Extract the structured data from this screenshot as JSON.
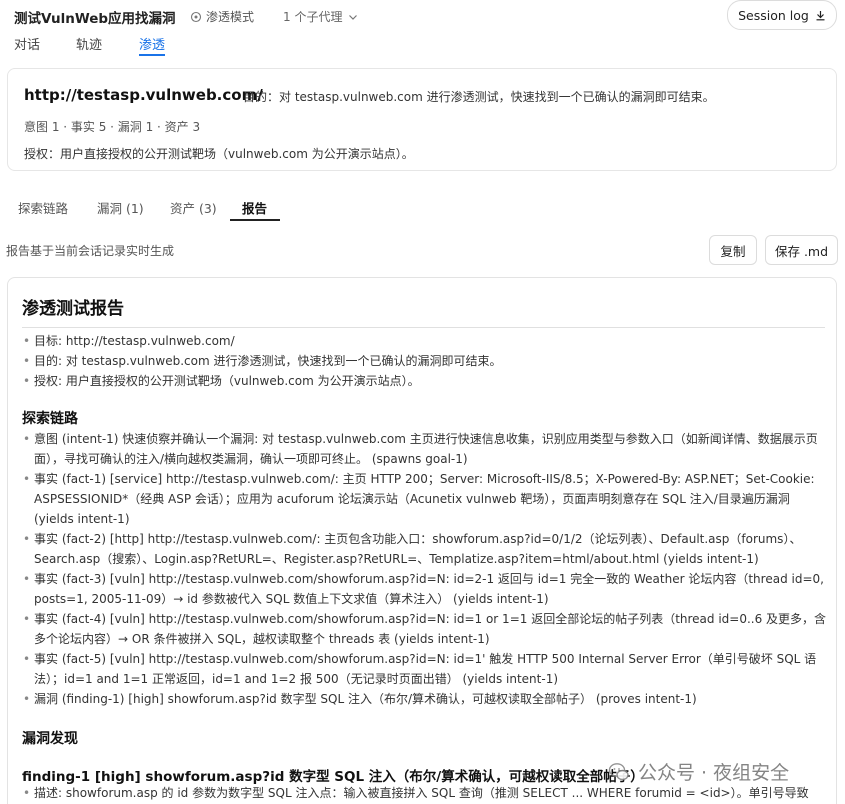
{
  "header": {
    "title": "测试VulnWeb应用找漏洞",
    "mode": "渗透模式",
    "agents": "1 个子代理",
    "session_log": "Session log"
  },
  "main_tabs": [
    "对话",
    "轨迹",
    "渗透"
  ],
  "target": {
    "url": "http://testasp.vulnweb.com/",
    "goal": "目的：对 testasp.vulnweb.com 进行渗透测试，快速找到一个已确认的漏洞即可结束。",
    "stats": "意图 1 · 事实 5 · 漏洞 1 · 资产 3",
    "auth": "授权：用户直接授权的公开测试靶场（vulnweb.com 为公开演示站点）。"
  },
  "sub_tabs": [
    "探索链路",
    "漏洞 (1)",
    "资产 (3)",
    "报告"
  ],
  "report_note": "报告基于当前会话记录实时生成",
  "buttons": {
    "copy": "复制",
    "save": "保存 .md"
  },
  "report": {
    "title": "渗透测试报告",
    "summary": [
      "目标: http://testasp.vulnweb.com/",
      "目的: 对 testasp.vulnweb.com 进行渗透测试，快速找到一个已确认的漏洞即可结束。",
      "授权: 用户直接授权的公开测试靶场（vulnweb.com 为公开演示站点）。"
    ],
    "chain_title": "探索链路",
    "chain": [
      "意图 (intent-1) 快速侦察并确认一个漏洞: 对 testasp.vulnweb.com 主页进行快速信息收集，识别应用类型与参数入口（如新闻详情、数据展示页面），寻找可确认的注入/横向越权类漏洞，确认一项即可终止。 (spawns goal-1)",
      "事实 (fact-1) [service] http://testasp.vulnweb.com/: 主页 HTTP 200；Server: Microsoft-IIS/8.5；X-Powered-By: ASP.NET；Set-Cookie: ASPSESSIONID*（经典 ASP 会话）；应用为 acuforum 论坛演示站（Acunetix vulnweb 靶场），页面声明刻意存在 SQL 注入/目录遍历漏洞 (yields intent-1)",
      "事实 (fact-2) [http] http://testasp.vulnweb.com/: 主页包含功能入口：showforum.asp?id=0/1/2（论坛列表）、Default.asp（forums）、Search.asp（搜索）、Login.asp?RetURL=、Register.asp?RetURL=、Templatize.asp?item=html/about.html (yields intent-1)",
      "事实 (fact-3) [vuln] http://testasp.vulnweb.com/showforum.asp?id=N: id=2-1 返回与 id=1 完全一致的 Weather 论坛内容（thread id=0, posts=1, 2005-11-09）→ id 参数被代入 SQL 数值上下文求值（算术注入） (yields intent-1)",
      "事实 (fact-4) [vuln] http://testasp.vulnweb.com/showforum.asp?id=N: id=1 or 1=1 返回全部论坛的帖子列表（thread id=0..6 及更多，含多个论坛内容）→ OR 条件被拼入 SQL，越权读取整个 threads 表 (yields intent-1)",
      "事实 (fact-5) [vuln] http://testasp.vulnweb.com/showforum.asp?id=N: id=1' 触发 HTTP 500 Internal Server Error（单引号破坏 SQL 语法）；id=1 and 1=1 正常返回，id=1 and 1=2 报 500（无记录时页面出错） (yields intent-1)",
      "漏洞 (finding-1) [high] showforum.asp?id 数字型 SQL 注入（布尔/算术确认，可越权读取全部帖子） (proves intent-1)"
    ],
    "findings_title": "漏洞发现",
    "finding_heading": "finding-1 [high] showforum.asp?id 数字型 SQL 注入（布尔/算术确认，可越权读取全部帖子）",
    "finding_items": [
      "描述: showforum.asp 的 id 参数为数字型 SQL 注入点：输入被直接拼入 SQL 查询（推测 SELECT ... WHERE forumid = <id>）。单引号导致"
    ]
  },
  "watermark": "公众号 · 夜组安全"
}
